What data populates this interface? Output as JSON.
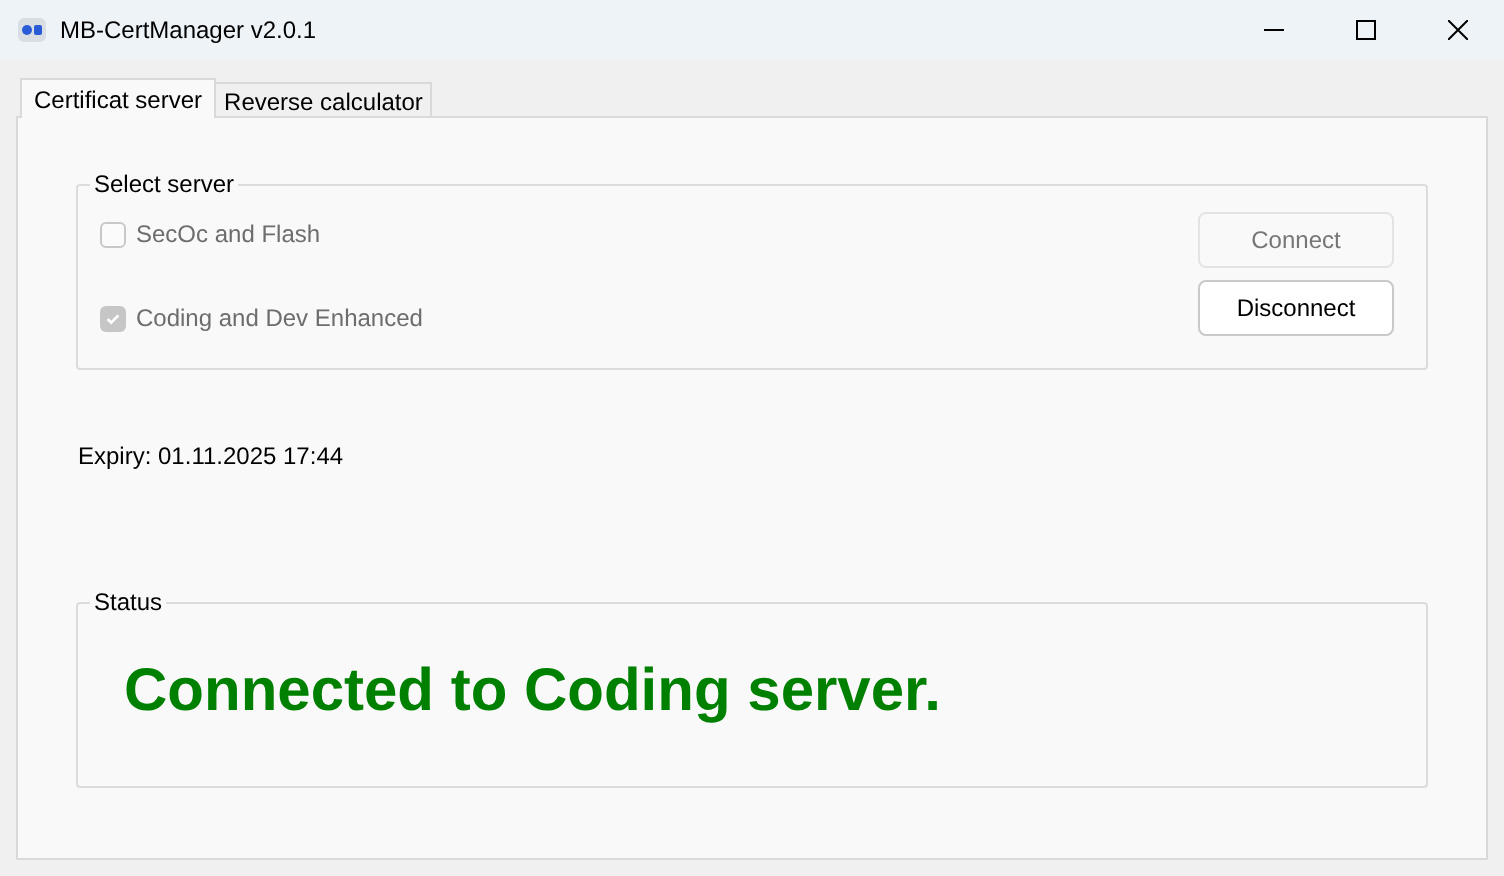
{
  "window": {
    "title": "MB-CertManager v2.0.1"
  },
  "tabs": [
    {
      "label": "Certificat server",
      "selected": true
    },
    {
      "label": "Reverse calculator",
      "selected": false
    }
  ],
  "select_server": {
    "title": "Select server",
    "options": [
      {
        "label": "SecOc and Flash",
        "checked": false,
        "disabled": true
      },
      {
        "label": "Coding and Dev Enhanced",
        "checked": true,
        "disabled": true
      }
    ],
    "buttons": [
      {
        "label": "Connect",
        "disabled": true
      },
      {
        "label": "Disconnect",
        "disabled": false
      }
    ]
  },
  "expiry": "Expiry: 01.11.2025 17:44",
  "status": {
    "title": "Status",
    "message": "Connected to Coding server.",
    "color": "#008000"
  }
}
